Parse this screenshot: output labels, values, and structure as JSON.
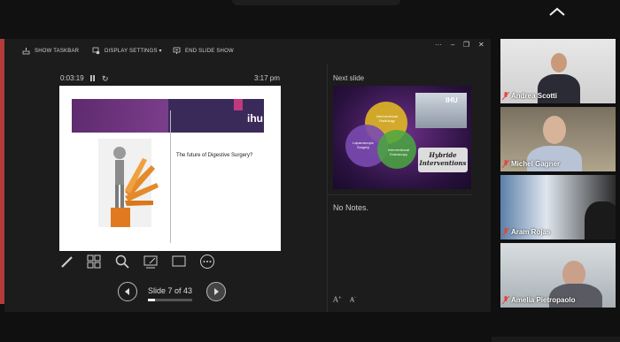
{
  "presenter_toolbar": {
    "show_taskbar": "SHOW TASKBAR",
    "display_settings": "DISPLAY SETTINGS ▾",
    "end_slide_show": "END SLIDE SHOW"
  },
  "window_controls": {
    "more": "···",
    "minimize": "–",
    "restore": "❐",
    "close": "✕"
  },
  "timer": {
    "elapsed": "0:03:19",
    "clock": "3:17 pm"
  },
  "current_slide": {
    "logo": "ihu",
    "text": "The future of Digestive Surgery?"
  },
  "navigation": {
    "slide_label": "Slide 7 of 43",
    "progress": 0.16
  },
  "next_slide": {
    "label": "Next slide",
    "venn": [
      "Interventional Radiology",
      "Laparoscopic Surgery",
      "Interventional Endoscopy"
    ],
    "photo_sign": "IHU",
    "hybrid_text": [
      "Hybride",
      "Interventions"
    ]
  },
  "notes": {
    "text": "No Notes."
  },
  "font_controls": {
    "increase": "A",
    "decrease": "A"
  },
  "participants": [
    {
      "name": "Andrea Scotti",
      "muted": true
    },
    {
      "name": "Michel Gagner",
      "muted": true
    },
    {
      "name": "Aram Rojas",
      "muted": true
    },
    {
      "name": "Amelia Pietropaolo",
      "muted": true
    }
  ],
  "colors": {
    "mute_red": "#e0463a",
    "slide_purple": "#5e2a6e"
  }
}
